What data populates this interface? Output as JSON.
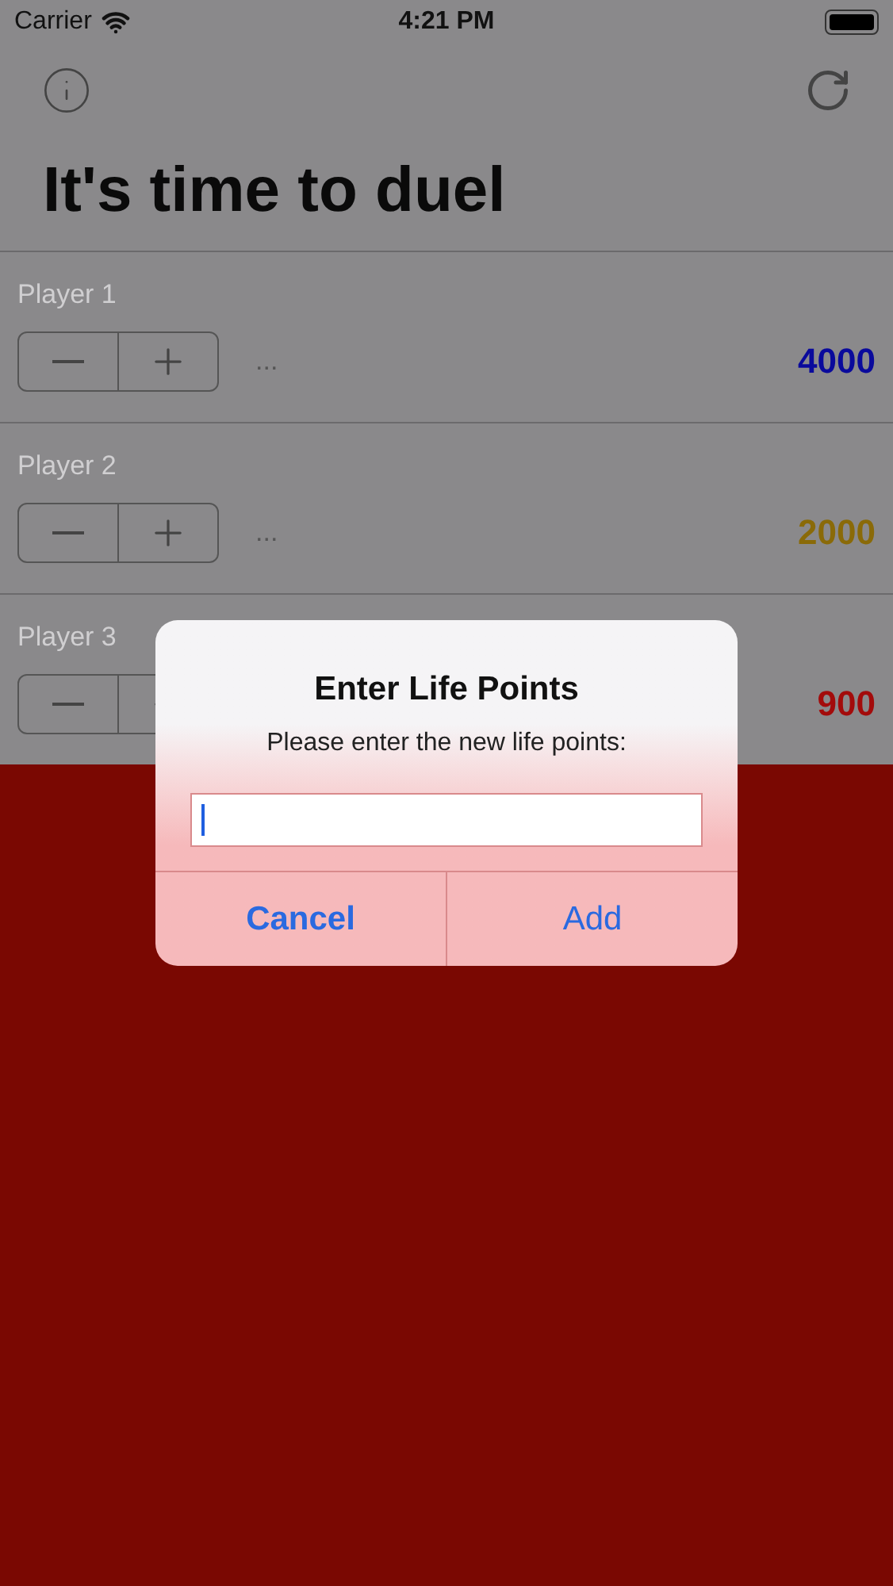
{
  "status_bar": {
    "carrier": "Carrier",
    "time": "4:21 PM"
  },
  "title": "It's time to duel",
  "players": [
    {
      "name": "Player 1",
      "more": "...",
      "points": "4000",
      "color": "#0a0a9c"
    },
    {
      "name": "Player 2",
      "more": "...",
      "points": "2000",
      "color": "#8a6a08"
    },
    {
      "name": "Player 3",
      "points": "900",
      "color": "#a30b0b"
    }
  ],
  "dialog": {
    "title": "Enter Life Points",
    "message": "Please enter the new life points:",
    "buttons": [
      {
        "label": "Cancel",
        "kind": "cancel"
      },
      {
        "label": "Add",
        "kind": "default"
      }
    ]
  }
}
